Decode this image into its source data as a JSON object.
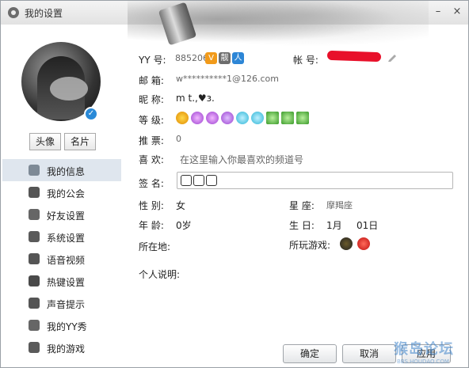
{
  "window": {
    "title": "我的设置",
    "minimize_glyph": "–",
    "close_glyph": "×"
  },
  "profile": {
    "avatar_button": "头像",
    "card_button": "名片"
  },
  "nav": {
    "items": [
      {
        "label": "我的信息",
        "icon": "id-card-icon",
        "active": true
      },
      {
        "label": "我的公会",
        "icon": "flag-icon"
      },
      {
        "label": "好友设置",
        "icon": "friends-gear-icon"
      },
      {
        "label": "系统设置",
        "icon": "gear-icon"
      },
      {
        "label": "语音视频",
        "icon": "webcam-icon"
      },
      {
        "label": "热键设置",
        "icon": "keyboard-key-icon"
      },
      {
        "label": "声音提示",
        "icon": "music-note-icon"
      },
      {
        "label": "我的YY秀",
        "icon": "shirt-icon"
      },
      {
        "label": "我的游戏",
        "icon": "game-g-icon"
      }
    ]
  },
  "info": {
    "yy_label": "YY 号:",
    "yy_value": "885206",
    "account_label": "帐 号:",
    "email_label": "邮 箱:",
    "email_value": "w**********1@126.com",
    "nickname_label": "昵 称:",
    "nickname_value": "m t.,♥ɜ.",
    "level_label": "等 级:",
    "recommend_label": "推 票:",
    "recommend_value": "0",
    "likes_label": "喜 欢:",
    "likes_placeholder": "在这里输入你最喜欢的频道号",
    "signature_label": "签 名:",
    "gender_label": "性 别:",
    "gender_value": "女",
    "age_label": "年 龄:",
    "age_value": "0岁",
    "location_label": "所在地:",
    "constellation_label": "星 座:",
    "constellation_value": "摩羯座",
    "birthday_label": "生 日:",
    "birthday_month": "1月",
    "birthday_day": "01日",
    "games_label": "所玩游戏:",
    "bio_label": "个人说明:"
  },
  "actions": {
    "ok": "确定",
    "cancel": "取消",
    "apply": "应用"
  },
  "watermark": {
    "text": "猴岛论坛",
    "sub": "BBS.HOUDAO.COM"
  },
  "colors": {
    "accent": "#2a8ad8",
    "redact": "#e8102a",
    "nav_active_bg": "#dfe6ee"
  }
}
